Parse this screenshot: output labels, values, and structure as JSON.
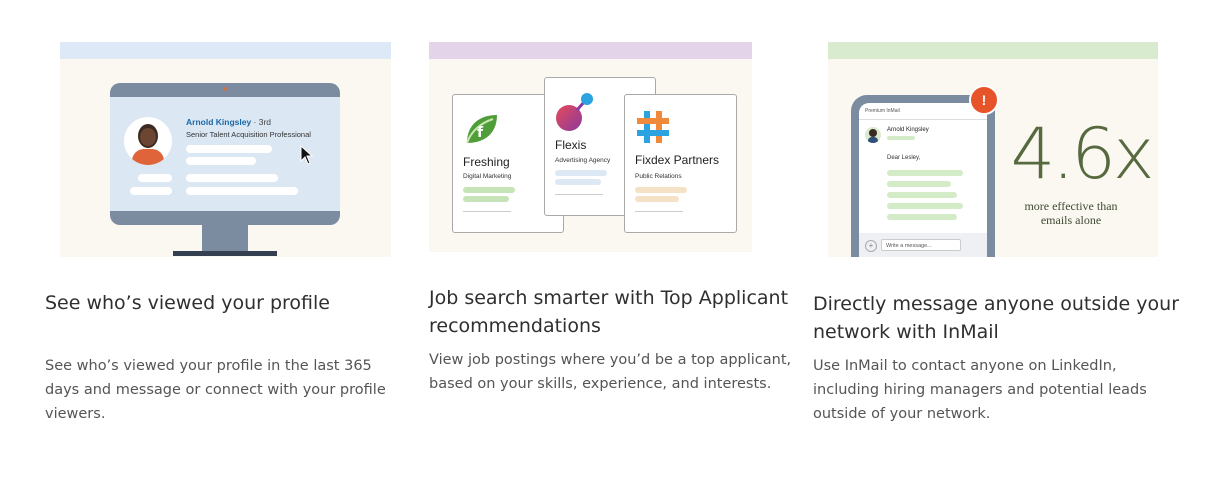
{
  "features": [
    {
      "heading": "See who’s viewed your profile",
      "description": "See who’s viewed your profile in the last 365 days and message or connect with your profile viewers.",
      "illustration": {
        "band_color": "#dde9f6",
        "viewer_name": "Arnold Kingsley",
        "viewer_degree": " · 3rd",
        "viewer_title": "Senior Talent Acquisition Professional"
      }
    },
    {
      "heading": "Job search smarter with Top Applicant recommendations",
      "description": "View job postings where you’d be a top applicant, based on your skills, experience, and interests.",
      "illustration": {
        "band_color": "#e3d4ea",
        "companies": [
          {
            "name": "Freshing",
            "industry": "Digital Marketing"
          },
          {
            "name": "Flexis",
            "industry": "Advertising Agency"
          },
          {
            "name": "Fixdex Partners",
            "industry": "Public Relations"
          }
        ]
      }
    },
    {
      "heading": "Directly message anyone outside your network with InMail",
      "description": "Use InMail to contact anyone on LinkedIn, including hiring managers and potential leads outside of your network.",
      "illustration": {
        "band_color": "#d9ebcf",
        "phone_header": "Premium InMail",
        "sender_name": "Arnold Kingsley",
        "greeting": "Dear Lesley,",
        "compose_placeholder": "Write a message...",
        "notification_badge": "!",
        "stat_value": "4.6x",
        "stat_caption": "more effective than emails alone"
      }
    }
  ]
}
